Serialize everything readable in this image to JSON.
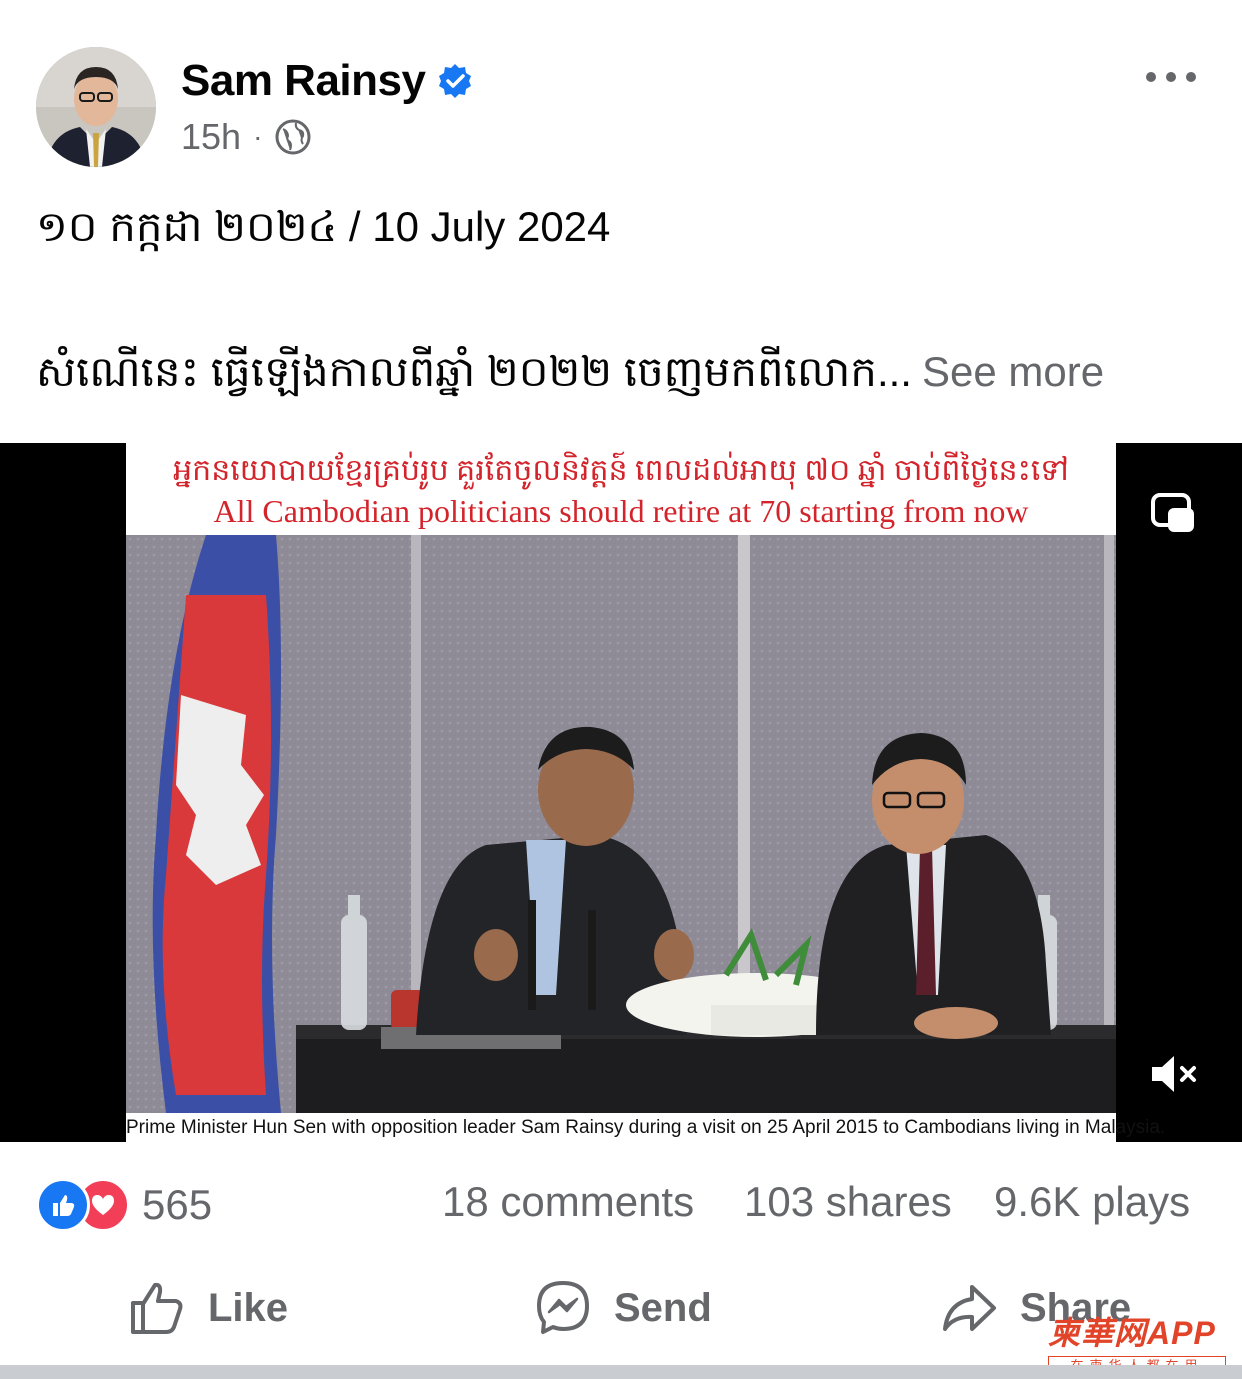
{
  "post": {
    "author": "Sam Rainsy",
    "time": "15h",
    "separator": "·",
    "date_line": "១០ កក្កដា ២០២៤ / 10 July 2024",
    "body_preview": "សំណេីនេះ ធ្វើឡើងកាលពីឆ្នាំ ២០២២ ចេញមកពីលោក...",
    "see_more": "See more"
  },
  "media": {
    "title_khmer": "អ្នកនយោបាយខ្មែរគ្រប់រូប គួរតែចូលនិវត្តន៍ ពេលដល់អាយុ ៧០ ឆ្នាំ ចាប់ពីថ្ងៃនេះទៅ",
    "title_english": "All Cambodian politicians should retire at 70 starting from now",
    "caption": "Prime Minister Hun Sen with opposition leader Sam Rainsy during a visit on 25 April 2015 to Cambodians living in Malaysia."
  },
  "stats": {
    "reactions": "565",
    "comments": "18 comments",
    "shares": "103 shares",
    "plays": "9.6K plays"
  },
  "actions": {
    "like": "Like",
    "send": "Send",
    "share": "Share"
  },
  "watermark": {
    "main": "柬華网APP",
    "sub": "在柬华人都在用"
  },
  "colors": {
    "accent": "#1877f2",
    "love": "#f33e58",
    "muted_text": "#65676b",
    "title_red": "#d3242b"
  },
  "icons": [
    "verified-badge-icon",
    "globe-icon",
    "more-options-icon",
    "picture-in-picture-icon",
    "mute-icon",
    "like-reaction-icon",
    "love-reaction-icon",
    "thumbs-up-icon",
    "messenger-icon",
    "share-arrow-icon"
  ]
}
